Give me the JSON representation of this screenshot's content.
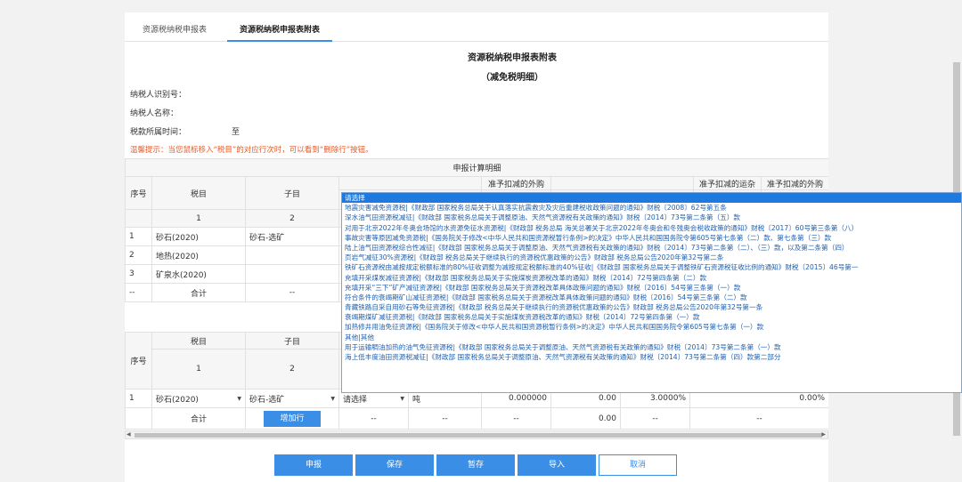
{
  "tabs": [
    "资源税纳税申报表",
    "资源税纳税申报表附表"
  ],
  "form": {
    "title": "资源税纳税申报表附表",
    "subtitle": "（减免税明细）",
    "taxpayer_id_label": "纳税人识别号：",
    "taxpayer_name_label": "纳税人名称：",
    "period_label": "税款所属时间：",
    "period_to": "至",
    "tip": "温馨提示：当您鼠标移入“税目”的对应行次时，可以看到“删除行”按钮。"
  },
  "table1": {
    "section_header": "申报计算明细",
    "col_no": "序号",
    "col_item": "税目",
    "col_sub": "子目",
    "col_deduct_purchase": "准予扣减的外购",
    "col_deduct_transport": "准予扣减的运杂",
    "col_deduct_purchase2": "准予扣减的外购",
    "num1": "1",
    "num2": "2",
    "rows": [
      {
        "no": "1",
        "item": "砂石(2020)",
        "sub": "砂石-选矿"
      },
      {
        "no": "2",
        "item": "地热(2020)",
        "sub": ""
      },
      {
        "no": "3",
        "item": "矿泉水(2020)",
        "sub": ""
      }
    ],
    "total_no": "--",
    "total_label": "合计",
    "total_sub": "--"
  },
  "table2": {
    "col_no": "序号",
    "col_item": "税目",
    "col_sub": "子目",
    "num1": "1",
    "num2": "2",
    "row": {
      "no": "1",
      "item": "砂石(2020)",
      "sub": "砂石-选矿",
      "select": "请选择",
      "unit": "吨",
      "v1": "0.000000",
      "v2": "0.00",
      "rate": "3.0000%",
      "pct": "0.00%"
    },
    "total_label": "合计",
    "add_row": "增加行",
    "dash": "--",
    "total_v": "0.00"
  },
  "buttons": {
    "declare": "申报",
    "save": "保存",
    "hold": "暂存",
    "import": "导入",
    "cancel": "取消"
  },
  "dropdown": {
    "items": [
      "请选择",
      "地震灾害减免资源税|《财政部 国家税务总局关于认真落实抗震救灾及灾后重建税收政策问题的通知》财税〔2008〕62号第五条",
      "深水油气田资源税减征|《财政部 国家税务总局关于调整原油、天然气资源税有关政策的通知》财税〔2014〕73号第二条第（五）款",
      "对用于北京2022年冬奥会场馆的水资源免征水资源税|《财政部 税务总局 海关总署关于北京2022年冬奥会和冬残奥会税收政策的通知》财税〔2017〕60号第三条第（八）",
      "事故灾害等原因减免资源税|《国务院关于修改<中华人民共和国资源税暂行条例>的决定》中华人民共和国国务院令第605号第七条第（二）款、第七条第（三）款",
      "陆上油气田资源税综合性减征|《财政部 国家税务总局关于调整原油、天然气资源税有关政策的通知》财税〔2014〕73号第二条第（二）、（三）款，以及第二条第（四）",
      "页岩气减征30%资源税|《财政部 税务总局关于继续执行的资源税优惠政策的公告》财政部 税务总局公告2020年第32号第二条",
      "铁矿石资源税由减按规定税额标准的80%征收调整为减按规定税额标准的40%征收|《财政部 国家税务总局关于调整铁矿石资源税征收比例的通知》财税〔2015〕46号第一",
      "充填开采煤炭减征资源税|《财政部 国家税务总局关于实施煤炭资源税改革的通知》财税〔2014〕72号第四条第（二）款",
      "充填开采“三下”矿产减征资源税|《财政部 国家税务总局关于资源税改革具体政策问题的通知》财税〔2016〕54号第三条第（一）款",
      "符合条件的衰竭期矿山减征资源税|《财政部 国家税务总局关于资源税改革具体政策问题的通知》财税〔2016〕54号第三条第（二）款",
      "青藏铁路自采自用砂石等免征资源税|《财政部 税务总局关于继续执行的资源税优惠政策的公告》财政部 税务总局公告2020年第32号第一条",
      "衰竭期煤矿减征资源税|《财政部 国家税务总局关于实施煤炭资源税改革的通知》财税〔2014〕72号第四条第（一）款",
      "加热修井用油免征资源税|《国务院关于修改<中华人民共和国资源税暂行条例>的决定》中华人民共和国国务院令第605号第七条第（一）款",
      "其他|其他",
      "用于运输稠油加热的油气免征资源税|《财政部 国家税务总局关于调整原油、天然气资源税有关政策的通知》财税〔2014〕73号第二条第（一）款",
      "海上低丰度油田资源税减征|《财政部 国家税务总局关于调整原油、天然气资源税有关政策的通知》财税〔2014〕73号第二条第（四）款第二部分"
    ]
  }
}
